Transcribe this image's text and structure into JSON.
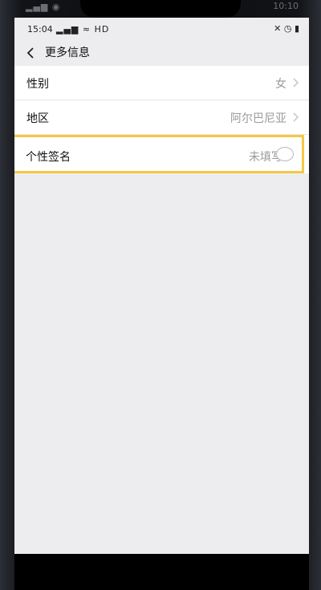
{
  "status": {
    "time": "15:04",
    "network": "HD"
  },
  "outer_status": {
    "clock": "10:10"
  },
  "header": {
    "title": "更多信息"
  },
  "rows": [
    {
      "label": "性别",
      "value": "女"
    },
    {
      "label": "地区",
      "value": "阿尔巴尼亚"
    },
    {
      "label": "个性签名",
      "value": "未填写"
    }
  ],
  "colors": {
    "highlight": "#f5c842",
    "background": "#ededf0"
  }
}
